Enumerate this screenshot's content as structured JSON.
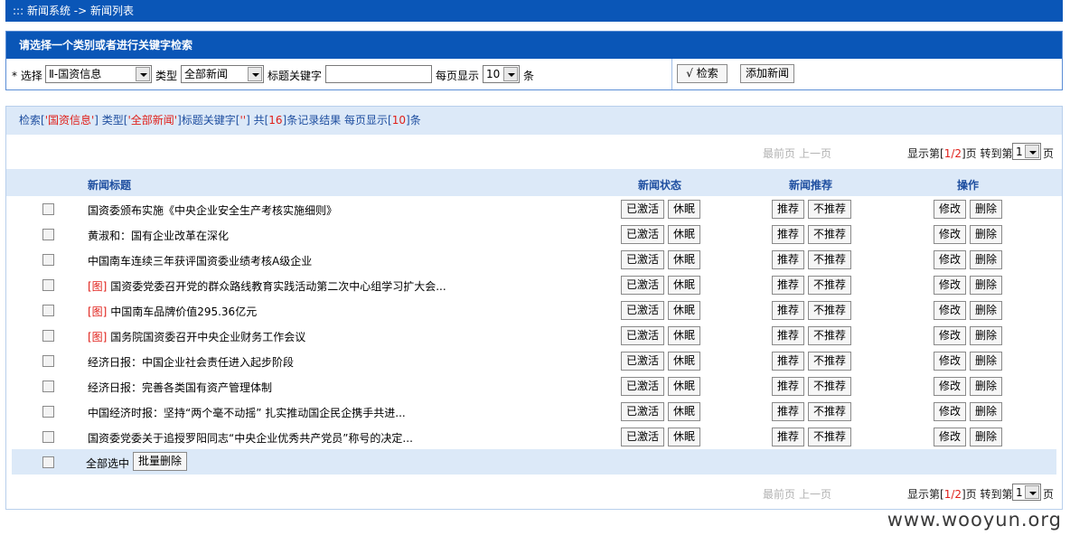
{
  "breadcrumb": "::: 新闻系统 -> 新闻列表",
  "search": {
    "header": "请选择一个类别或者进行关键字检索",
    "select_label": "* 选择",
    "category_value": "Ⅱ-国资信息",
    "type_label": "类型",
    "type_value": "全部新闻",
    "keyword_label": "标题关键字",
    "keyword_value": "",
    "per_page_label": "每页显示",
    "per_page_value": "10",
    "per_page_unit": "条",
    "search_button": "√ 检索",
    "add_button": "添加新闻"
  },
  "summary": {
    "p1": "检索[",
    "category": "'国资信息'",
    "p2": "] 类型[",
    "type": "'全部新闻'",
    "p3": "]标题关键字[",
    "keyword": "''",
    "p4": "] 共[",
    "count": "16",
    "p5": "]条记录结果 每页显示[",
    "per_page": "10",
    "p6": "]条"
  },
  "pager": {
    "first": "最前页",
    "prev": "上一页",
    "info_p1": "显示第[",
    "current": "1/2",
    "info_p2": "]页 转到第",
    "goto_value": "1",
    "info_p3": "页"
  },
  "table": {
    "headers": {
      "title": "新闻标题",
      "status": "新闻状态",
      "recommend": "新闻推荐",
      "action": "操作"
    },
    "btn_activate": "已激活",
    "btn_sleep": "休眠",
    "btn_recommend": "推荐",
    "btn_unrecommend": "不推荐",
    "btn_edit": "修改",
    "btn_delete": "删除",
    "img_tag": "[图]",
    "rows": [
      {
        "title": "国资委颁布实施《中央企业安全生产考核实施细则》",
        "img": ""
      },
      {
        "title": "黄淑和：国有企业改革在深化",
        "img": ""
      },
      {
        "title": "中国南车连续三年获评国资委业绩考核A级企业",
        "img": ""
      },
      {
        "title": "国资委党委召开党的群众路线教育实践活动第二次中心组学习扩大会...",
        "img": "[图]"
      },
      {
        "title": "中国南车品牌价值295.36亿元",
        "img": "[图]"
      },
      {
        "title": "国务院国资委召开中央企业财务工作会议",
        "img": "[图]"
      },
      {
        "title": "经济日报：中国企业社会责任进入起步阶段",
        "img": ""
      },
      {
        "title": "经济日报：完善各类国有资产管理体制",
        "img": ""
      },
      {
        "title": "中国经济时报：坚持“两个毫不动摇” 扎实推动国企民企携手共进...",
        "img": ""
      },
      {
        "title": "国资委党委关于追授罗阳同志“中央企业优秀共产党员”称号的决定...",
        "img": ""
      }
    ],
    "select_all_label": "全部选中",
    "batch_delete": "批量删除"
  },
  "watermark": "www.wooyun.org"
}
